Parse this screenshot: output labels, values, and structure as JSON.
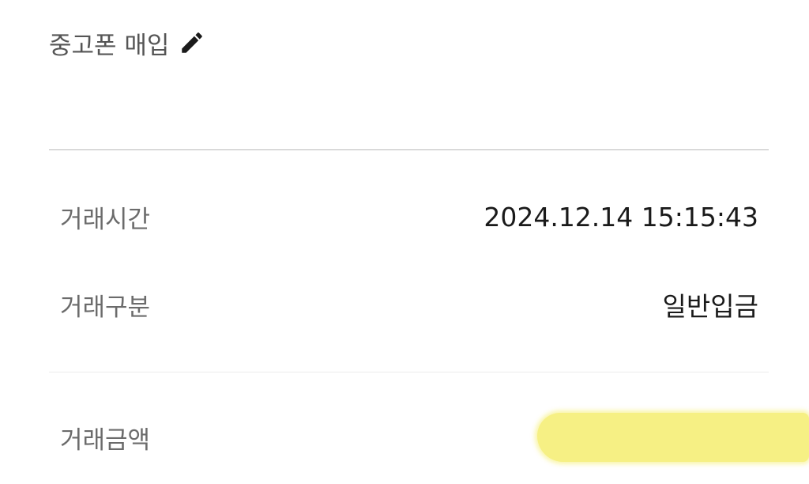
{
  "memo": {
    "text": "중고폰 매입",
    "edit_icon": "pencil-icon"
  },
  "details": {
    "time": {
      "label": "거래시간",
      "value": "2024.12.14 15:15:43"
    },
    "type": {
      "label": "거래구분",
      "value": "일반입금"
    }
  },
  "amount": {
    "label": "거래금액",
    "value_masked": true,
    "mask_color": "#f6ef7a"
  }
}
